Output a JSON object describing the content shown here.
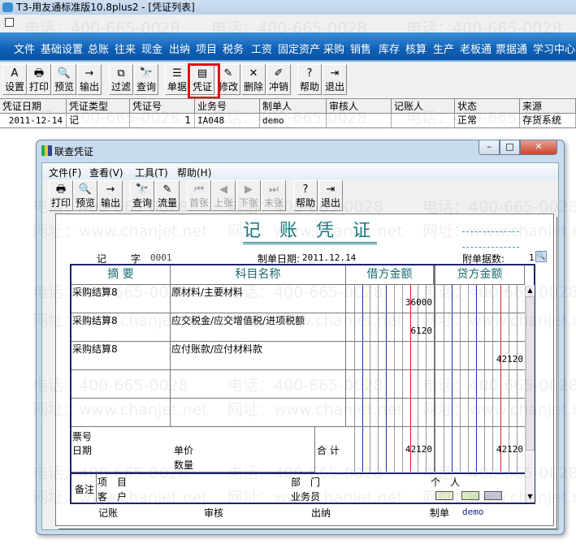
{
  "app": {
    "title": "T3-用友通标准版10.8plus2 - [凭证列表]"
  },
  "watermarks": {
    "phone": "电话：400-665-0028",
    "site": "网址：www.chanjet.net"
  },
  "menu": [
    "文件",
    "基础设置",
    "总账",
    "往来",
    "现金",
    "出纳",
    "项目",
    "税务",
    "工资",
    "固定资产",
    "采购",
    "销售",
    "库存",
    "核算",
    "生产",
    "老板通",
    "票据通",
    "学习中心"
  ],
  "toolbar": [
    {
      "label": "设置",
      "icon": "A"
    },
    {
      "label": "打印",
      "icon": "🖶"
    },
    {
      "label": "预览",
      "icon": "🔍"
    },
    {
      "label": "输出",
      "icon": "→"
    },
    {
      "label": "过滤",
      "icon": "⧉"
    },
    {
      "label": "查询",
      "icon": "🔭"
    },
    {
      "label": "单据",
      "icon": "☰"
    },
    {
      "label": "凭证",
      "icon": "▤"
    },
    {
      "label": "修改",
      "icon": "✎"
    },
    {
      "label": "删除",
      "icon": "✕"
    },
    {
      "label": "冲销",
      "icon": "✐"
    },
    {
      "label": "帮助",
      "icon": "?"
    },
    {
      "label": "退出",
      "icon": "⇥"
    }
  ],
  "list": {
    "columns": [
      "凭证日期",
      "凭证类型",
      "凭证号",
      "业务号",
      "制单人",
      "审核人",
      "记账人",
      "状态",
      "来源"
    ],
    "rows": [
      [
        "2011-12-14",
        "记",
        "1",
        "IA048",
        "demo",
        "",
        "",
        "正常",
        "存货系统"
      ]
    ]
  },
  "dialog": {
    "title": "联查凭证",
    "menu": [
      "文件(F)",
      "查看(V)",
      "工具(T)",
      "帮助(H)"
    ],
    "toolbar": [
      {
        "label": "打印",
        "icon": "🖶",
        "enabled": true
      },
      {
        "label": "预览",
        "icon": "🔍",
        "enabled": true
      },
      {
        "label": "输出",
        "icon": "→",
        "enabled": true
      },
      {
        "label": "查询",
        "icon": "🔭",
        "enabled": true
      },
      {
        "label": "流量",
        "icon": "✎",
        "enabled": true
      },
      {
        "label": "首张",
        "icon": "⏮",
        "enabled": false
      },
      {
        "label": "上张",
        "icon": "◀",
        "enabled": false
      },
      {
        "label": "下张",
        "icon": "▶",
        "enabled": false
      },
      {
        "label": "末张",
        "icon": "⏭",
        "enabled": false
      },
      {
        "label": "帮助",
        "icon": "?",
        "enabled": true
      },
      {
        "label": "退出",
        "icon": "⇥",
        "enabled": true
      }
    ],
    "voucher": {
      "title": "记 账 凭 证",
      "type_label": "记",
      "zi_label": "字",
      "number": "0001",
      "date_label": "制单日期:",
      "date": "2011.12.14",
      "attach_label": "附单据数:",
      "attach": "1",
      "headers": [
        "摘 要",
        "科目名称",
        "借方金额",
        "贷方金额"
      ],
      "entries": [
        {
          "summary": "采购结算8",
          "account": "原材料/主要材料",
          "debit": "36000",
          "credit": ""
        },
        {
          "summary": "采购结算8",
          "account": "应交税金/应交增值税/进项税额",
          "debit": "6120",
          "credit": ""
        },
        {
          "summary": "采购结算8",
          "account": "应付账款/应付材料款",
          "debit": "",
          "credit": "42120"
        },
        {
          "summary": "",
          "account": "",
          "debit": "",
          "credit": ""
        },
        {
          "summary": "",
          "account": "",
          "debit": "",
          "credit": ""
        }
      ],
      "ticket_label": "票号",
      "date_field_label": "日期",
      "price_label": "单价",
      "qty_label": "数量",
      "total_label": "合 计",
      "total_debit": "42120",
      "total_credit": "42120",
      "remark_label": "备注",
      "project_label": "项　目",
      "customer_label": "客　户",
      "dept_label": "部　门",
      "salesman_label": "业务员",
      "person_label": "个　人",
      "footer": {
        "post_label": "记账",
        "audit_label": "审核",
        "cashier_label": "出纳",
        "maker_label": "制单",
        "maker": "demo"
      }
    }
  }
}
